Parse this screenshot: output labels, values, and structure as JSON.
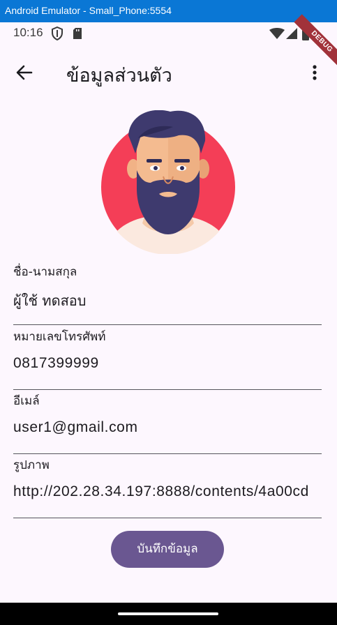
{
  "window": {
    "title": "Android Emulator - Small_Phone:5554"
  },
  "status_bar": {
    "time": "10:16"
  },
  "debug_banner": {
    "label": "DEBUG"
  },
  "app_bar": {
    "title": "ข้อมูลส่วนตัว"
  },
  "form": {
    "name": {
      "label": "ชื่อ-นามสกุล",
      "value": "ผู้ใช้ ทดสอบ"
    },
    "phone": {
      "label": "หมายเลขโทรศัพท์",
      "value": "0817399999"
    },
    "email": {
      "label": "อีเมล์",
      "value": "user1@gmail.com"
    },
    "image": {
      "label": "รูปภาพ",
      "value": "http://202.28.34.197:8888/contents/4a00cd"
    }
  },
  "save_button": {
    "label": "บันทึกข้อมูล"
  },
  "colors": {
    "window_titlebar": "#0a77d5",
    "background": "#fdf7fe",
    "primary_button": "#6a5791",
    "avatar_circle": "#f43e57",
    "debug_ribbon": "#a1323a"
  },
  "icons": [
    "shield-icon",
    "sd-card-icon",
    "wifi-icon",
    "signal-icon",
    "battery-icon",
    "back-arrow-icon",
    "more-vert-icon"
  ]
}
